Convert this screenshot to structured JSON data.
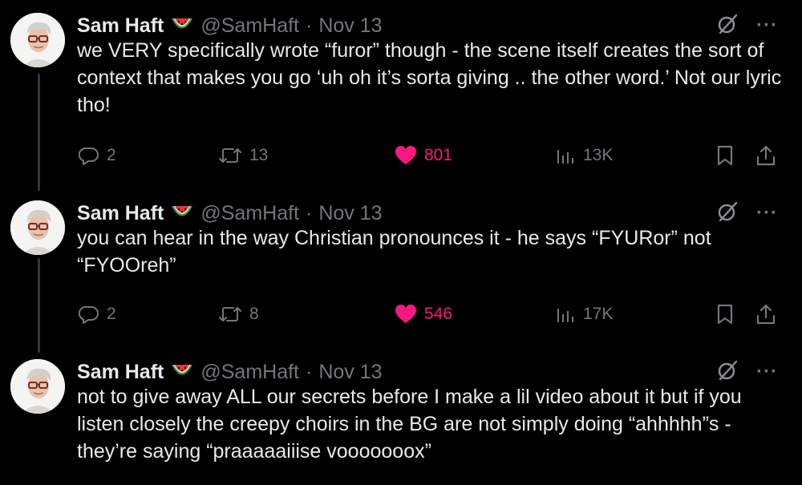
{
  "tweets": [
    {
      "author": {
        "name": "Sam Haft",
        "handle": "@SamHaft",
        "date": "Nov 13",
        "emoji": "watermelon"
      },
      "text": "we VERY specifically wrote “furor” though - the scene itself creates the sort of context that makes you go ‘uh oh it’s sorta giving .. the other word.’ Not our lyric tho!",
      "stats": {
        "replies": "2",
        "reposts": "13",
        "likes": "801",
        "views": "13K"
      },
      "liked": true
    },
    {
      "author": {
        "name": "Sam Haft",
        "handle": "@SamHaft",
        "date": "Nov 13",
        "emoji": "watermelon"
      },
      "text": "you can hear in the way Christian pronounces it - he says “FYURor” not “FYOOreh”",
      "stats": {
        "replies": "2",
        "reposts": "8",
        "likes": "546",
        "views": "17K"
      },
      "liked": true
    },
    {
      "author": {
        "name": "Sam Haft",
        "handle": "@SamHaft",
        "date": "Nov 13",
        "emoji": "watermelon"
      },
      "text": "not to give away ALL our secrets before I make a lil video about it but if you listen closely the creepy choirs in the BG are not simply doing “ahhhhh”s - they’re saying “praaaaaiiise vooooooox”"
    }
  ],
  "ui": {
    "separator": "·",
    "more": "···"
  },
  "colors": {
    "background": "#000000",
    "text": "#e7e9ea",
    "muted": "#71767b",
    "like": "#f91880",
    "thread_line": "#333639"
  }
}
